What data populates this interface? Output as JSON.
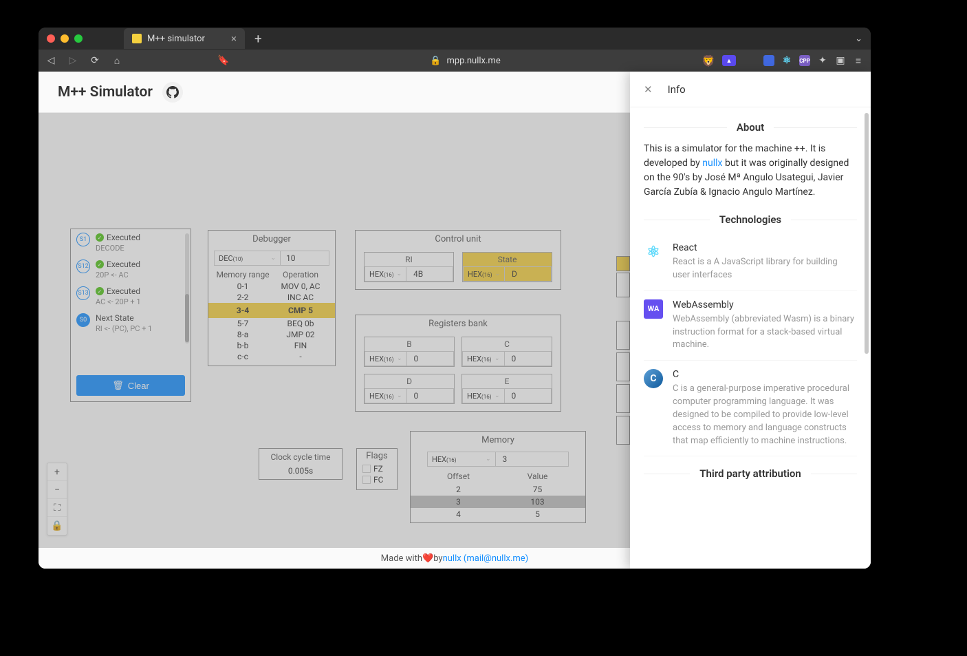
{
  "browser": {
    "tab_title": "M++ simulator",
    "url": "mpp.nullx.me"
  },
  "app": {
    "title": "M++ Simulator"
  },
  "states": {
    "items": [
      {
        "badge": "S1",
        "status": "Executed",
        "desc": "DECODE"
      },
      {
        "badge": "S12",
        "status": "Executed",
        "desc": "20P <- AC"
      },
      {
        "badge": "S13",
        "status": "Executed",
        "desc": "AC <- 20P + 1"
      },
      {
        "badge": "S0",
        "status": "Next State",
        "desc": "RI <- (PC), PC + 1",
        "solid": true,
        "no_check": true
      }
    ],
    "clear_label": "Clear"
  },
  "debugger": {
    "title": "Debugger",
    "base_sel": "DEC",
    "base_sub": "(10)",
    "base_val": "10",
    "col1": "Memory range",
    "col2": "Operation",
    "rows": [
      {
        "r": "0-1",
        "op": "MOV 0, AC"
      },
      {
        "r": "2-2",
        "op": "INC AC"
      },
      {
        "r": "3-4",
        "op": "CMP 5",
        "hl": true
      },
      {
        "r": "5-7",
        "op": "BEQ 0b"
      },
      {
        "r": "8-a",
        "op": "JMP 02"
      },
      {
        "r": "b-b",
        "op": "FIN"
      },
      {
        "r": "c-c",
        "op": "-"
      }
    ]
  },
  "control_unit": {
    "title": "Control unit",
    "ri": {
      "label": "RI",
      "sel": "HEX",
      "sub": "(16)",
      "val": "4B"
    },
    "state": {
      "label": "State",
      "sel": "HEX",
      "sub": "(16)",
      "val": "D",
      "hl": true
    }
  },
  "registers": {
    "title": "Registers bank",
    "regs": [
      {
        "label": "B",
        "sel": "HEX",
        "sub": "(16)",
        "val": "0"
      },
      {
        "label": "C",
        "sel": "HEX",
        "sub": "(16)",
        "val": "0"
      },
      {
        "label": "D",
        "sel": "HEX",
        "sub": "(16)",
        "val": "0"
      },
      {
        "label": "E",
        "sel": "HEX",
        "sub": "(16)",
        "val": "0"
      }
    ]
  },
  "clock": {
    "title": "Clock cycle time",
    "val": "0.005s"
  },
  "flags": {
    "title": "Flags",
    "items": [
      "FZ",
      "FC"
    ]
  },
  "memory": {
    "title": "Memory",
    "sel": "HEX",
    "sub": "(16)",
    "addr": "3",
    "col1": "Offset",
    "col2": "Value",
    "rows": [
      {
        "o": "2",
        "v": "75"
      },
      {
        "o": "3",
        "v": "103",
        "hl": true
      },
      {
        "o": "4",
        "v": "5"
      }
    ]
  },
  "footer": {
    "prefix": "Made with ",
    "heart": "❤️",
    "by": " by ",
    "link": "nullx (mail@nullx.me)"
  },
  "drawer": {
    "title": "Info",
    "about_heading": "About",
    "about_text_1": "This is a simulator for the machine ++. It is developed by ",
    "about_link": "nullx",
    "about_text_2": " but it was originally designed on the 90's by José Mª Angulo Usategui, Javier García Zubía & Ignacio Angulo Martínez.",
    "tech_heading": "Technologies",
    "techs": [
      {
        "name": "React",
        "desc": "React is a A JavaScript library for building user interfaces",
        "icon_bg": "#e8f4fd",
        "icon_fg": "#61dafb",
        "icon_text": "⚛"
      },
      {
        "name": "WebAssembly",
        "desc": "WebAssembly (abbreviated Wasm) is a binary instruction format for a stack-based virtual machine.",
        "icon_bg": "#654ff0",
        "icon_fg": "#fff",
        "icon_text": "WA"
      },
      {
        "name": "C",
        "desc": "C is a general-purpose imperative procedural computer programming language. It was designed to be compiled to provide low-level access to memory and language constructs that map efficiently to machine instructions.",
        "icon_bg": "#0f5a9c",
        "icon_fg": "#fff",
        "icon_text": "C"
      }
    ],
    "third_party_heading": "Third party attribution"
  }
}
